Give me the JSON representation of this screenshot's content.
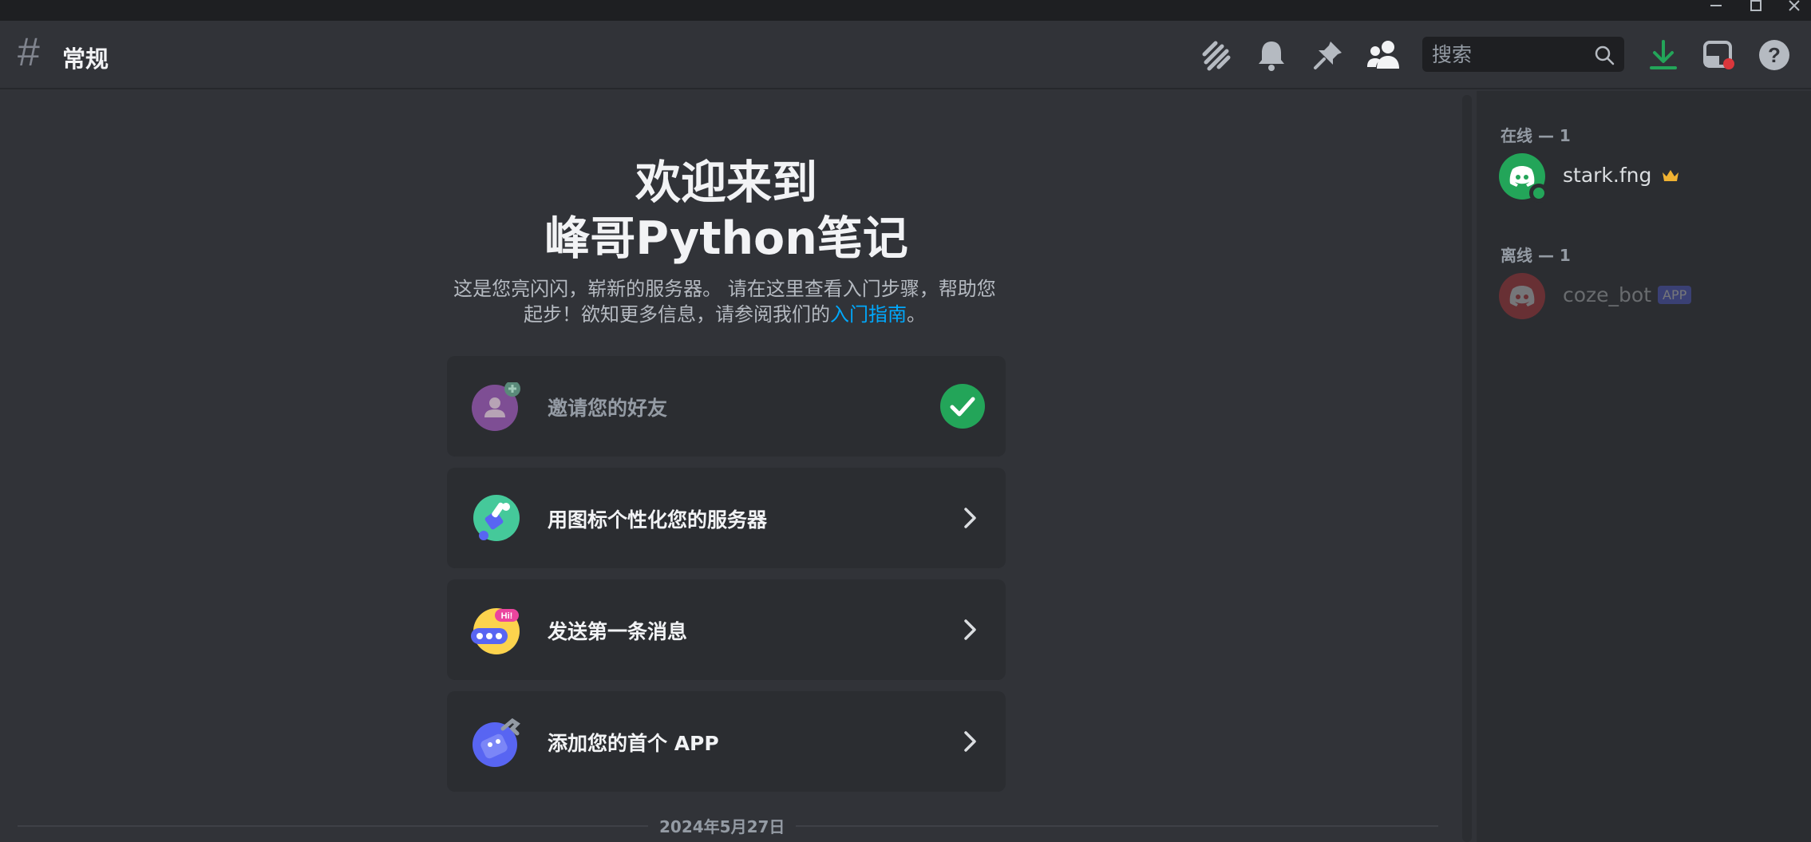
{
  "header": {
    "channel_name": "常规",
    "search_placeholder": "搜索"
  },
  "welcome": {
    "title_line1": "欢迎来到",
    "title_line2": "峰哥Python笔记",
    "desc_line1": "这是您亮闪闪，崭新的服务器。 请在这里查看入门步骤，帮助您",
    "desc_line2_prefix": "起步！欲知更多信息，请参阅我们的",
    "desc_link": "入门指南",
    "desc_line2_suffix": "。"
  },
  "cards": [
    {
      "label": "邀请您的好友",
      "done": true,
      "icon": "invite-friends-icon"
    },
    {
      "label": "用图标个性化您的服务器",
      "done": false,
      "icon": "paintbrush-icon"
    },
    {
      "label": "发送第一条消息",
      "done": false,
      "icon": "message-bubble-icon"
    },
    {
      "label": "添加您的首个 APP",
      "done": false,
      "icon": "robot-app-icon"
    }
  ],
  "date_divider": "2024年5月27日",
  "members": {
    "online_header": "在线 — 1",
    "offline_header": "离线 — 1",
    "online": [
      {
        "name": "stark.fng",
        "owner": true
      }
    ],
    "offline": [
      {
        "name": "coze_bot",
        "badge": "APP"
      }
    ]
  },
  "colors": {
    "accent_green": "#23a559",
    "link_blue": "#00a8fc",
    "owner_gold": "#f0b232",
    "offline_red": "#da373c",
    "app_badge": "#5865f2"
  }
}
